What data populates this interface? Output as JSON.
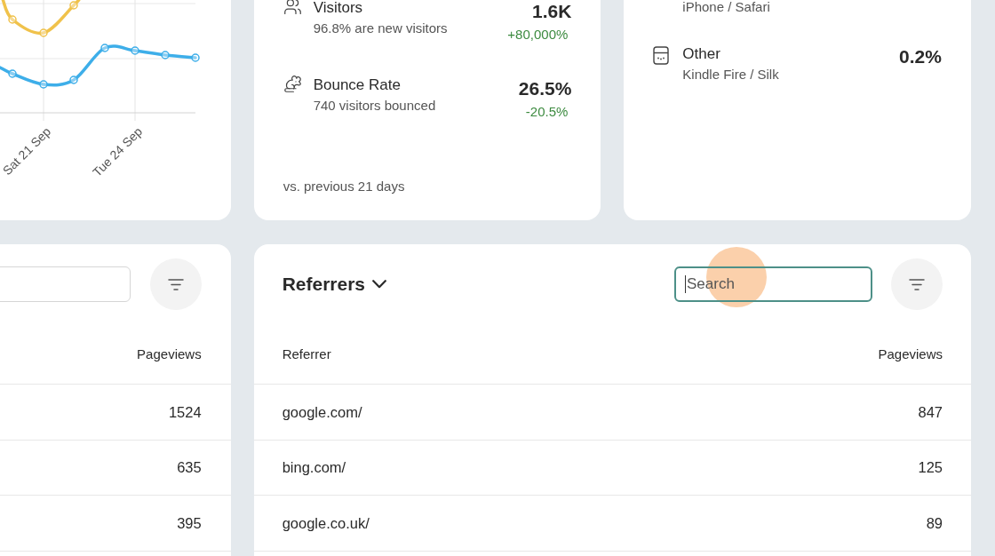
{
  "traffic_chart": {
    "x_labels": [
      "Sat 21 Sep",
      "Tue 24 Sep"
    ],
    "series": [
      {
        "color": "#f0c24b"
      },
      {
        "color": "#3daee9"
      }
    ]
  },
  "summary": {
    "metrics": [
      {
        "kind": "visitors",
        "title": "Visitors",
        "detail": "96.8% are new visitors",
        "value": "1.6K",
        "change": "+80,000%",
        "positive": true
      },
      {
        "kind": "bounce",
        "title": "Bounce Rate",
        "detail": "740 visitors bounced",
        "value": "26.5%",
        "change": "-20.5%",
        "positive": true
      }
    ],
    "footnote": "vs. previous 21 days"
  },
  "devices": {
    "items": [
      {
        "detail": "iPhone / Safari"
      },
      {
        "kind": "other",
        "name": "Other",
        "detail": "Kindle Fire / Silk",
        "share": "0.2%"
      }
    ]
  },
  "pages_panel": {
    "search": {
      "focused": false
    },
    "columns": [
      "Pageviews"
    ],
    "rows": [
      [
        "1524"
      ],
      [
        "635"
      ],
      [
        "395"
      ]
    ]
  },
  "referrers_panel": {
    "title": "Referrers",
    "search": {
      "placeholder": "Search",
      "focused": true,
      "click_highlight": true
    },
    "columns": [
      "Referrer",
      "Pageviews"
    ],
    "rows": [
      [
        "google.com/",
        "847"
      ],
      [
        "bing.com/",
        "125"
      ],
      [
        "google.co.uk/",
        "89"
      ]
    ]
  }
}
